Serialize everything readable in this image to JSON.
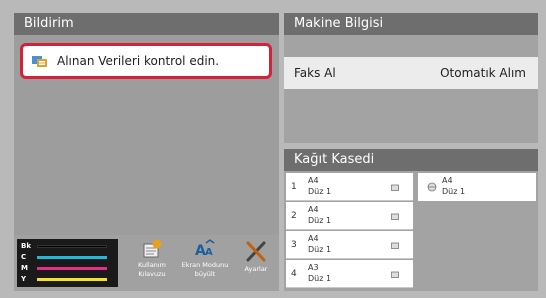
{
  "notification": {
    "title": "Bildirim",
    "message": "Alınan Verileri kontrol edin."
  },
  "toolbar": {
    "toner": [
      {
        "label": "Bk",
        "color": "#000000"
      },
      {
        "label": "C",
        "color": "#22b8d8"
      },
      {
        "label": "M",
        "color": "#e0308a"
      },
      {
        "label": "Y",
        "color": "#f2e228"
      }
    ],
    "manual_label_line1": "Kullanım",
    "manual_label_line2": "Kılavuzu",
    "screen_mode_line1": "Ekran Modunu",
    "screen_mode_line2": "büyült",
    "settings_label": "Ayarlar"
  },
  "machine": {
    "title": "Makine Bilgisi",
    "fax_label": "Faks Al",
    "fax_value": "Otomatık Alım"
  },
  "paper": {
    "title": "Kağıt Kasedi",
    "trays": [
      {
        "num": "1",
        "size": "A4",
        "type": "Düz 1"
      },
      {
        "num": "2",
        "size": "A4",
        "type": "Düz 1"
      },
      {
        "num": "3",
        "size": "A4",
        "type": "Düz 1"
      },
      {
        "num": "4",
        "size": "A3",
        "type": "Düz 1"
      }
    ],
    "bypass": {
      "size": "A4",
      "type": "Düz 1"
    }
  },
  "colors": {
    "header": "#6e6e6e",
    "highlight": "#d6213a"
  },
  "icons": [
    "message-icon",
    "manual-icon",
    "screen-mode-icon",
    "settings-icon",
    "paper-icon",
    "bypass-tray-icon"
  ]
}
